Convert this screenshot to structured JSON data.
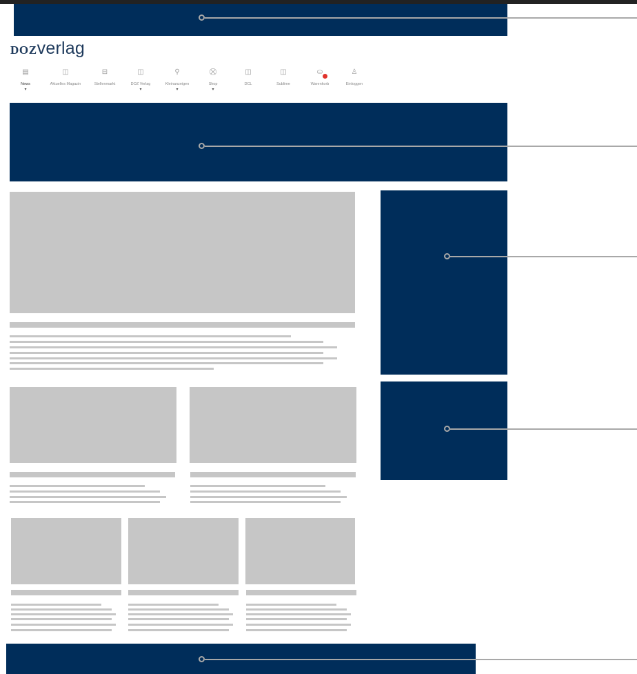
{
  "brand": {
    "logo_bold": "DOZ",
    "logo_light": "verlag"
  },
  "nav": {
    "items": [
      {
        "id": "news",
        "label": "News",
        "icon": "newspaper-icon",
        "has_dropdown": true,
        "active": true
      },
      {
        "id": "aktuelles-magazin",
        "label": "Aktuelles Magazin",
        "icon": "book-icon",
        "has_dropdown": false
      },
      {
        "id": "stellenmarkt",
        "label": "Stellenmarkt",
        "icon": "briefcase-icon",
        "has_dropdown": false
      },
      {
        "id": "doz-verlag",
        "label": "DOZ Verlag",
        "icon": "book-icon",
        "has_dropdown": true
      },
      {
        "id": "kleinanzeigen",
        "label": "Kleinanzeigen",
        "icon": "pin-icon",
        "has_dropdown": true
      },
      {
        "id": "shop",
        "label": "Shop",
        "icon": "cart-icon",
        "has_dropdown": true
      },
      {
        "id": "dcl",
        "label": "DCL",
        "icon": "book-icon",
        "has_dropdown": false
      },
      {
        "id": "sublime",
        "label": "Sublime",
        "icon": "book-icon",
        "has_dropdown": false
      },
      {
        "id": "warenkorb",
        "label": "Warenkorb",
        "icon": "basket-icon",
        "has_dropdown": false,
        "badge": true
      },
      {
        "id": "einloggen",
        "label": "Einloggen",
        "icon": "user-icon",
        "has_dropdown": false
      }
    ]
  },
  "colors": {
    "ad_slot": "#002d5a",
    "placeholder": "#c6c6c6",
    "connector": "#a8a8a8",
    "badge": "#e0322b",
    "top_bar": "#222222"
  },
  "icons": {
    "newspaper-icon": "▤",
    "book-icon": "◫",
    "briefcase-icon": "⊟",
    "pin-icon": "⚲",
    "cart-icon": "⛒",
    "basket-icon": "⛀",
    "user-icon": "♙",
    "caret": "▾"
  }
}
